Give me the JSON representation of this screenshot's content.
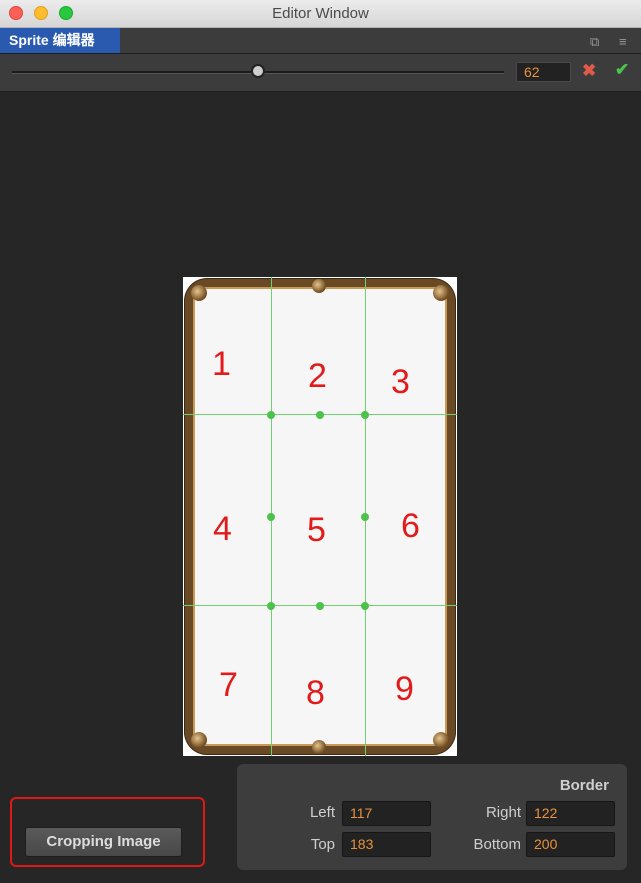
{
  "window": {
    "title": "Editor Window"
  },
  "tab": {
    "label": "Sprite 编辑器"
  },
  "toolbar": {
    "zoom_value": "62",
    "slider_fraction": 0.5
  },
  "sprite_cells": [
    "1",
    "2",
    "3",
    "4",
    "5",
    "6",
    "7",
    "8",
    "9"
  ],
  "crop_button": {
    "label": "Cropping Image"
  },
  "border_panel": {
    "title": "Border",
    "left_label": "Left",
    "left_value": "117",
    "right_label": "Right",
    "right_value": "122",
    "top_label": "Top",
    "top_value": "183",
    "bottom_label": "Bottom",
    "bottom_value": "200"
  },
  "colors": {
    "tab_accent": "#2a5ab0",
    "value_text": "#e8923c",
    "guide_line": "#6fd26f",
    "highlight_box": "#e01818"
  },
  "icons": [
    "close-window-icon",
    "minimize-window-icon",
    "maximize-window-icon",
    "popout-icon",
    "menu-icon",
    "cancel-icon",
    "confirm-icon"
  ]
}
